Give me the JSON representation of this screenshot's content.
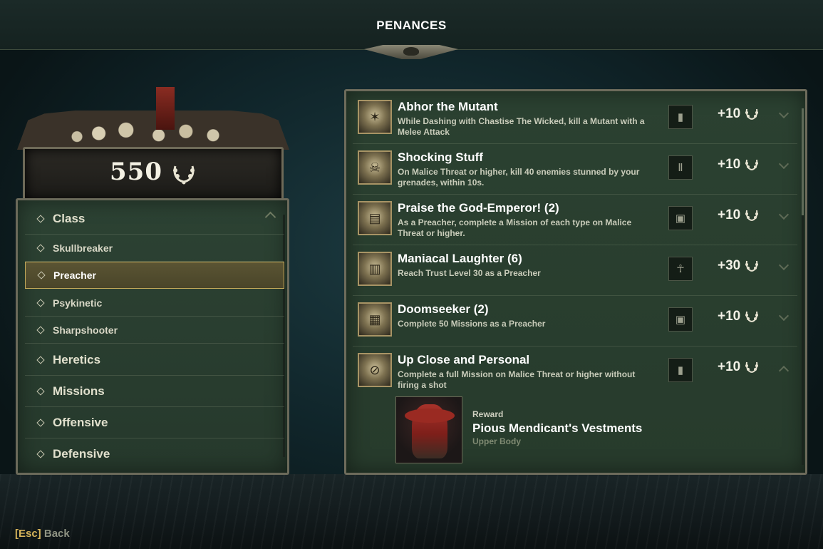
{
  "header": {
    "title": "PENANCES"
  },
  "score": {
    "value": "550",
    "icon": "laurel-wreath-icon"
  },
  "categories": [
    {
      "label": "Class",
      "kind": "major",
      "expanded": true
    },
    {
      "label": "Skullbreaker",
      "kind": "minor"
    },
    {
      "label": "Preacher",
      "kind": "minor",
      "selected": true
    },
    {
      "label": "Psykinetic",
      "kind": "minor"
    },
    {
      "label": "Sharpshooter",
      "kind": "minor"
    },
    {
      "label": "Heretics",
      "kind": "major"
    },
    {
      "label": "Missions",
      "kind": "major"
    },
    {
      "label": "Offensive",
      "kind": "major"
    },
    {
      "label": "Defensive",
      "kind": "major"
    }
  ],
  "penances": [
    {
      "title": "Abhor the Mutant",
      "desc": "While Dashing with Chastise The Wicked, kill a Mutant with a Melee Attack",
      "points": "+10",
      "icon": "mutant-icon",
      "reward_icon": "upper-body-icon",
      "expanded": false
    },
    {
      "title": "Shocking Stuff",
      "desc": "On Malice Threat or higher, kill 40 enemies stunned by your grenades, within 10s.",
      "points": "+10",
      "icon": "skull-icon",
      "reward_icon": "lower-body-icon",
      "expanded": false
    },
    {
      "title": "Praise the God-Emperor! (2)",
      "desc": "As a Preacher, complete a Mission of each type on Malice Threat or higher.",
      "points": "+10",
      "icon": "scroll-icon",
      "reward_icon": "portrait-frame-icon",
      "expanded": false
    },
    {
      "title": "Maniacal Laughter (6)",
      "desc": "Reach Trust Level 30 as a Preacher",
      "points": "+30",
      "icon": "book-icon",
      "reward_icon": "emote-icon",
      "expanded": false
    },
    {
      "title": "Doomseeker (2)",
      "desc": "Complete 50 Missions as a Preacher",
      "points": "+10",
      "icon": "tome-icon",
      "reward_icon": "portrait-frame-icon",
      "expanded": false
    },
    {
      "title": "Up Close and Personal",
      "desc": "Complete a full Mission on Malice Threat or higher without firing a shot",
      "points": "+10",
      "icon": "no-gun-icon",
      "reward_icon": "upper-body-icon",
      "expanded": true
    }
  ],
  "reward": {
    "label": "Reward",
    "name": "Pious Mendicant's Vestments",
    "type": "Upper Body"
  },
  "footer": {
    "key": "[Esc]",
    "label": "Back"
  },
  "colors": {
    "accent_gold": "#c4aa5a",
    "panel_green": "#2b4131",
    "key_gold": "#d6b35a"
  }
}
